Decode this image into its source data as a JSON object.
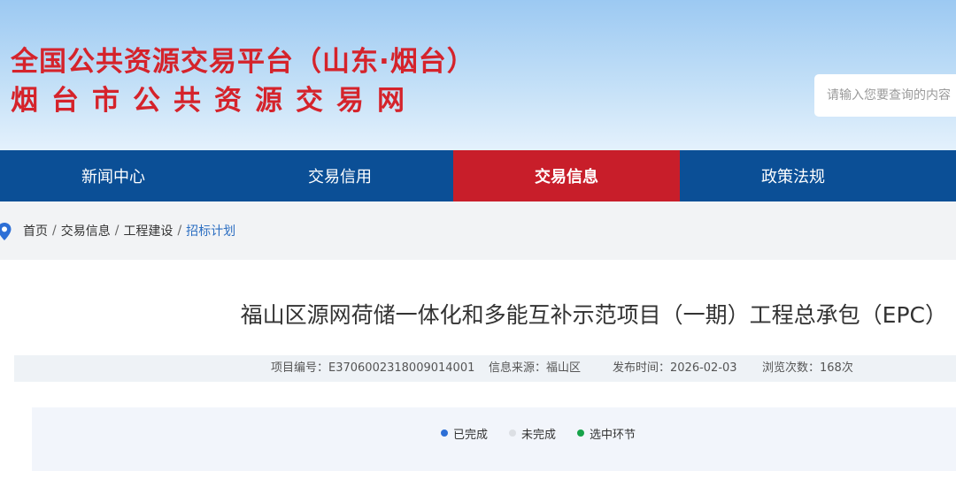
{
  "header": {
    "title_line1": "全国公共资源交易平台（山东·烟台）",
    "title_line2": "烟台市公共资源交易网",
    "title_color": "#d5232b",
    "search_placeholder": "请输入您要查询的内容"
  },
  "nav": {
    "items": [
      {
        "label": "新闻中心"
      },
      {
        "label": "交易信用"
      },
      {
        "label": "交易信息",
        "active": true
      },
      {
        "label": "政策法规"
      }
    ],
    "bg_color": "#0b4f96",
    "active_color": "#c81e2a"
  },
  "breadcrumb": {
    "items": [
      "首页",
      "交易信息",
      "工程建设",
      "招标计划"
    ],
    "separator": "/"
  },
  "article": {
    "title": "福山区源网荷储一体化和多能互补示范项目（一期）工程总承包（EPC）",
    "meta": {
      "project_no": "项目编号：E3706002318009014001",
      "source": "信息来源：福山区",
      "publish_time": "发布时间：2026-02-03",
      "views": "浏览次数：168次"
    }
  },
  "legend": {
    "items": [
      {
        "label": "已完成",
        "color": "#2d6fd6"
      },
      {
        "label": "未完成",
        "color": "#dcdfe4"
      },
      {
        "label": "选中环节",
        "color": "#17a34a"
      }
    ]
  }
}
